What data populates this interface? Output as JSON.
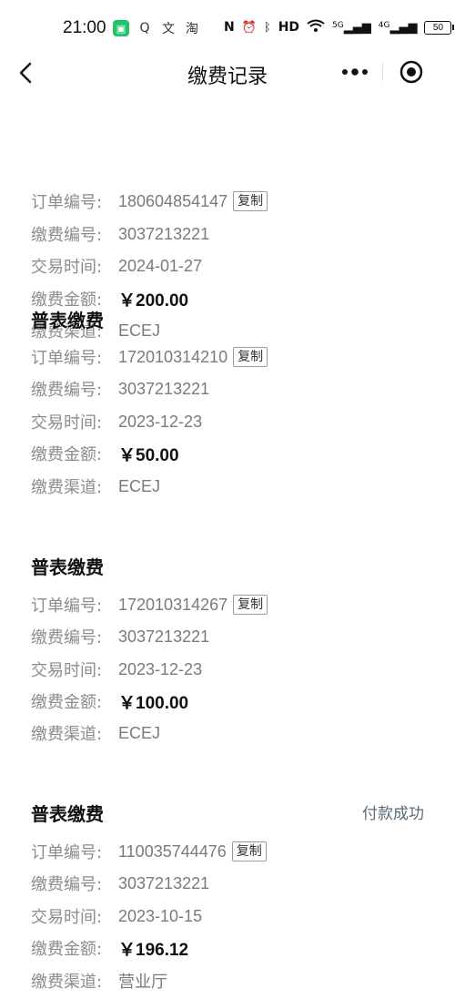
{
  "status_bar": {
    "time": "21:00",
    "left_apps": [
      {
        "icon": "app-notification-icon",
        "glyph": "▣"
      },
      {
        "icon": "search-app-icon",
        "glyph": "Q"
      },
      {
        "icon": "app-text-icon",
        "glyph": "文"
      },
      {
        "icon": "taobao-icon",
        "glyph": "淘"
      }
    ],
    "nfc": "N",
    "hd": "HD",
    "signal1": "5G",
    "signal2": "4G",
    "battery": "50"
  },
  "nav": {
    "title": "缴费记录"
  },
  "labels": {
    "order_no": "订单编号:",
    "payment_no": "缴费编号:",
    "trade_time": "交易时间:",
    "amount": "缴费金额:",
    "channel": "缴费渠道:",
    "copy": "复制"
  },
  "records": [
    {
      "title": "",
      "status": "",
      "order_no": "180604854147",
      "payment_no": "3037213221",
      "trade_time": "2024-01-27",
      "amount": "￥200.00",
      "channel": "ECEJ"
    },
    {
      "title": "普表缴费",
      "status": "",
      "order_no": "172010314210",
      "payment_no": "3037213221",
      "trade_time": "2023-12-23",
      "amount": "￥50.00",
      "channel": "ECEJ"
    },
    {
      "title": "普表缴费",
      "status": "",
      "order_no": "172010314267",
      "payment_no": "3037213221",
      "trade_time": "2023-12-23",
      "amount": "￥100.00",
      "channel": "ECEJ"
    },
    {
      "title": "普表缴费",
      "status": "付款成功",
      "order_no": "110035744476",
      "payment_no": "3037213221",
      "trade_time": "2023-10-15",
      "amount": "￥196.12",
      "channel": "营业厅"
    }
  ]
}
